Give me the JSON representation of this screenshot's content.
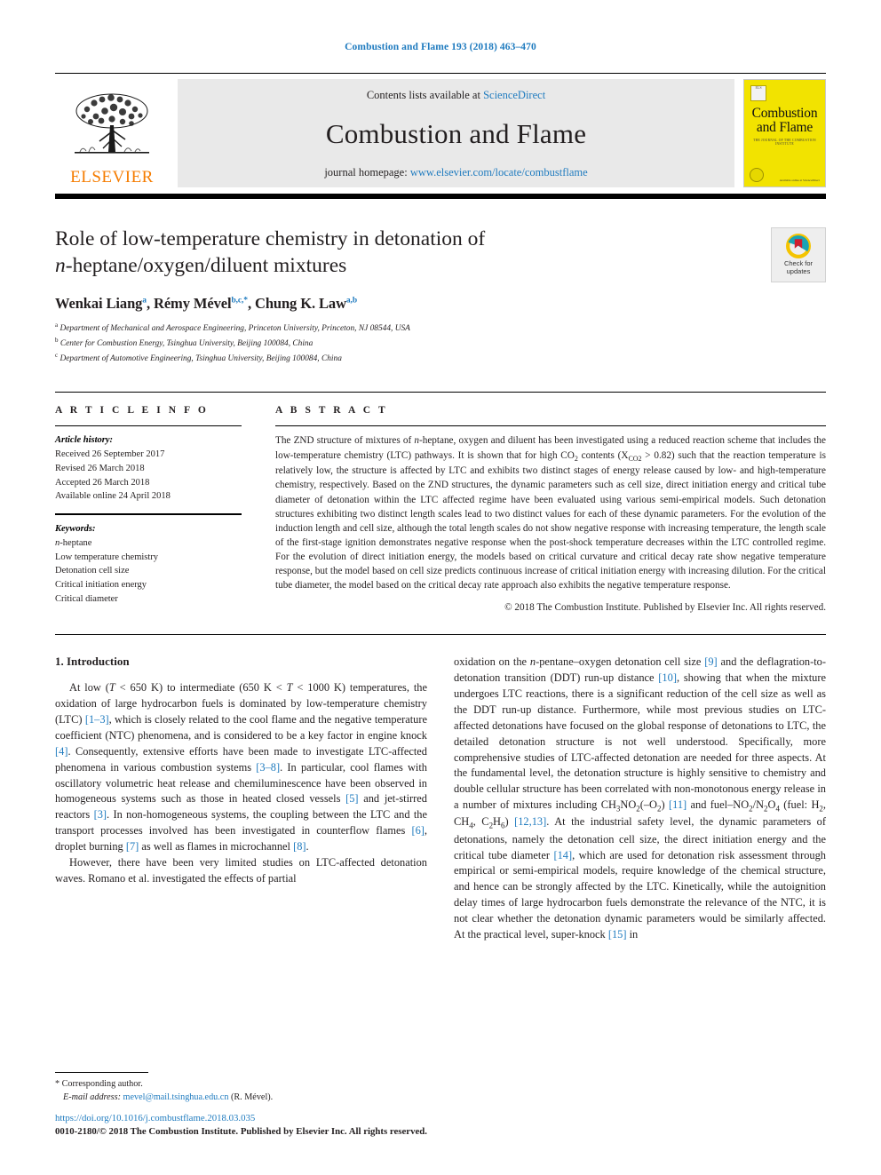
{
  "running_head": "Combustion and Flame 193 (2018) 463–470",
  "masthead": {
    "contents_prefix": "Contents lists available at ",
    "sciencedirect": "ScienceDirect",
    "journal_name": "Combustion and Flame",
    "homepage_prefix": "journal homepage: ",
    "homepage_url": "www.elsevier.com/locate/combustflame",
    "publisher": "ELSEVIER",
    "cover": {
      "title_line1": "Combustion",
      "title_line2": "and Flame",
      "subtitle": "THE JOURNAL OF THE COMBUSTION INSTITUTE",
      "sciencedirect_note": "Available online at\nScienceDirect"
    }
  },
  "article": {
    "title_line1": "Role of low-temperature chemistry in detonation of",
    "title_line2_italic": "n",
    "title_line2_rest": "-heptane/oxygen/diluent mixtures",
    "authors_plain": "Wenkai Liang a, Rémy Mével b,c,*, Chung K. Law a,b",
    "authors": [
      {
        "name": "Wenkai Liang",
        "sup": "a",
        "sep": ", "
      },
      {
        "name": "Rémy Mével",
        "sup": "b,c,",
        "star": "*",
        "sep": ", "
      },
      {
        "name": "Chung K. Law",
        "sup": "a,b",
        "sep": ""
      }
    ],
    "affiliations": [
      {
        "mark": "a",
        "text": "Department of Mechanical and Aerospace Engineering, Princeton University, Princeton, NJ 08544, USA"
      },
      {
        "mark": "b",
        "text": "Center for Combustion Energy, Tsinghua University, Beijing 100084, China"
      },
      {
        "mark": "c",
        "text": "Department of Automotive Engineering, Tsinghua University, Beijing 100084, China"
      }
    ],
    "crossmark_label": "Check for\nupdates"
  },
  "article_info": {
    "heading": "A R T I C L E   I N F O",
    "history_label": "Article history:",
    "history": [
      "Received 26 September 2017",
      "Revised 26 March 2018",
      "Accepted 26 March 2018",
      "Available online 24 April 2018"
    ],
    "keywords_label": "Keywords:",
    "keywords": [
      "n-heptane",
      "Low temperature chemistry",
      "Detonation cell size",
      "Critical initiation energy",
      "Critical diameter"
    ]
  },
  "abstract": {
    "heading": "A B S T R A C T",
    "text": "The ZND structure of mixtures of n-heptane, oxygen and diluent has been investigated using a reduced reaction scheme that includes the low-temperature chemistry (LTC) pathways. It is shown that for high CO2 contents (XCO2 > 0.82) such that the reaction temperature is relatively low, the structure is affected by LTC and exhibits two distinct stages of energy release caused by low- and high-temperature chemistry, respectively. Based on the ZND structures, the dynamic parameters such as cell size, direct initiation energy and critical tube diameter of detonation within the LTC affected regime have been evaluated using various semi-empirical models. Such detonation structures exhibiting two distinct length scales lead to two distinct values for each of these dynamic parameters. For the evolution of the induction length and cell size, although the total length scales do not show negative response with increasing temperature, the length scale of the first-stage ignition demonstrates negative response when the post-shock temperature decreases within the LTC controlled regime. For the evolution of direct initiation energy, the models based on critical curvature and critical decay rate show negative temperature response, but the model based on cell size predicts continuous increase of critical initiation energy with increasing dilution. For the critical tube diameter, the model based on the critical decay rate approach also exhibits the negative temperature response.",
    "copyright": "© 2018 The Combustion Institute. Published by Elsevier Inc. All rights reserved."
  },
  "body": {
    "section_heading": "1. Introduction",
    "left_paragraphs": [
      "At low (T < 650 K) to intermediate (650 K < T < 1000 K) temperatures, the oxidation of large hydrocarbon fuels is dominated by low-temperature chemistry (LTC) [1–3], which is closely related to the cool flame and the negative temperature coefficient (NTC) phenomena, and is considered to be a key factor in engine knock [4]. Consequently, extensive efforts have been made to investigate LTC-affected phenomena in various combustion systems [3–8]. In particular, cool flames with oscillatory volumetric heat release and chemiluminescence have been observed in homogeneous systems such as those in heated closed vessels [5] and jet-stirred reactors [3]. In non-homogeneous systems, the coupling between the LTC and the transport processes involved has been investigated in counterflow flames [6], droplet burning [7] as well as flames in microchannel [8].",
      "However, there have been very limited studies on LTC-affected detonation waves. Romano et al. investigated the effects of partial"
    ],
    "right_paragraphs": [
      "oxidation on the n-pentane–oxygen detonation cell size [9] and the deflagration-to-detonation transition (DDT) run-up distance [10], showing that when the mixture undergoes LTC reactions, there is a significant reduction of the cell size as well as the DDT run-up distance. Furthermore, while most previous studies on LTC-affected detonations have focused on the global response of detonations to LTC, the detailed detonation structure is not well understood. Specifically, more comprehensive studies of LTC-affected detonation are needed for three aspects. At the fundamental level, the detonation structure is highly sensitive to chemistry and double cellular structure has been correlated with non-monotonous energy release in a number of mixtures including CH3NO2(–O2) [11] and fuel–NO2/N2O4 (fuel: H2, CH4, C2H6) [12,13]. At the industrial safety level, the dynamic parameters of detonations, namely the detonation cell size, the direct initiation energy and the critical tube diameter [14], which are used for detonation risk assessment through empirical or semi-empirical models, require knowledge of the chemical structure, and hence can be strongly affected by the LTC. Kinetically, while the autoignition delay times of large hydrocarbon fuels demonstrate the relevance of the NTC, it is not clear whether the detonation dynamic parameters would be similarly affected. At the practical level, super-knock [15] in"
    ]
  },
  "footnote": {
    "corresponding_marker": "*",
    "corresponding_label": "Corresponding author.",
    "email_label": "E-mail address:",
    "email": "mevel@mail.tsinghua.edu.cn",
    "email_owner": "(R. Mével)."
  },
  "footer": {
    "doi": "https://doi.org/10.1016/j.combustflame.2018.03.035",
    "issn_line": "0010-2180/© 2018 The Combustion Institute. Published by Elsevier Inc. All rights reserved."
  },
  "colors": {
    "link_blue": "#1f7bbf",
    "elsevier_orange": "#F57C00",
    "cover_yellow": "#F2E300",
    "masthead_grey": "#e9e9e9"
  }
}
